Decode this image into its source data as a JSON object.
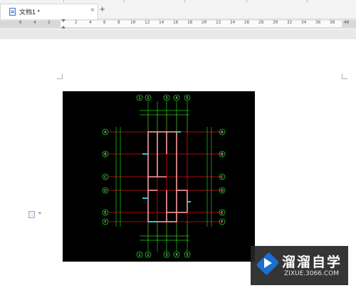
{
  "tabs": {
    "active_title": "文档1 *",
    "close_glyph": "×",
    "new_tab_glyph": "+",
    "scroll_glyph": "<"
  },
  "ruler": {
    "left_labels": [
      "6",
      "4",
      "2"
    ],
    "right_labels": [
      "2",
      "4",
      "6",
      "8",
      "10",
      "12",
      "14",
      "16",
      "18",
      "20",
      "22",
      "24",
      "26",
      "28",
      "30",
      "32",
      "34",
      "36",
      "38",
      "40"
    ]
  },
  "cad_drawing": {
    "axis_labels_top": [
      "1",
      "2",
      "3",
      "4",
      "5"
    ],
    "axis_labels_bottom": [
      "1",
      "2",
      "3",
      "4",
      "5"
    ],
    "axis_labels_left": [
      "A",
      "B",
      "C",
      "D",
      "E",
      "F"
    ],
    "axis_labels_right": [
      "A",
      "B",
      "C",
      "D",
      "E",
      "F"
    ],
    "colors": {
      "background": "#000000",
      "axis_lines": "#e01010",
      "dimension_lines": "#19d019",
      "walls": "#ff9aa0",
      "windows": "#19d0e0"
    }
  },
  "watermark": {
    "title": "溜溜自学",
    "url": "ZIXUE.3066.COM"
  }
}
